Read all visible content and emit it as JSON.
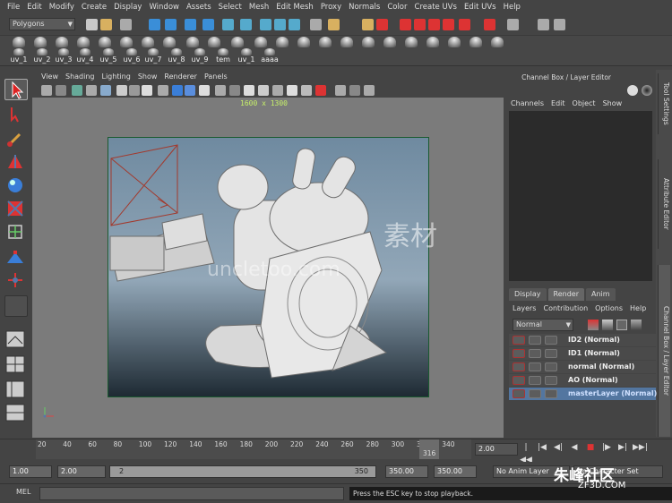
{
  "menubar": [
    "File",
    "Edit",
    "Modify",
    "Create",
    "Display",
    "Window",
    "Assets",
    "Select",
    "Mesh",
    "Edit Mesh",
    "Proxy",
    "Normals",
    "Color",
    "Create UVs",
    "Edit UVs",
    "Help"
  ],
  "statusline": {
    "menuset": "Polygons"
  },
  "shelf": {
    "items": [
      "uv_1",
      "uv_2",
      "uv_3",
      "uv_4",
      "uv_5",
      "uv_6",
      "uv_7",
      "uv_8",
      "uv_9",
      "tem",
      "uv_1",
      "aaaa"
    ]
  },
  "viewport": {
    "menu": [
      "View",
      "Shading",
      "Lighting",
      "Show",
      "Renderer",
      "Panels"
    ],
    "resolution": "1600 x 1300"
  },
  "channelbox": {
    "title": "Channel Box / Layer Editor",
    "menu": [
      "Channels",
      "Edit",
      "Object",
      "Show"
    ]
  },
  "sidetabs": [
    "Tool Settings",
    "Attribute Editor",
    "Channel Box / Layer Editor"
  ],
  "layers": {
    "tabs": [
      "Display",
      "Render",
      "Anim"
    ],
    "menu": [
      "Layers",
      "Contribution",
      "Options",
      "Help"
    ],
    "blend": "Normal",
    "rows": [
      "ID2 (Normal)",
      "ID1 (Normal)",
      "normal (Normal)",
      "AO (Normal)",
      "masterLayer (Normal)"
    ]
  },
  "timeline": {
    "ticks": [
      "20",
      "40",
      "60",
      "80",
      "100",
      "120",
      "140",
      "160",
      "180",
      "200",
      "220",
      "240",
      "260",
      "280",
      "300",
      "320",
      "340"
    ],
    "current": "316",
    "field": "2.00"
  },
  "range": {
    "start": "1.00",
    "start2": "2.00",
    "slider_start": "2",
    "slider_end": "350",
    "end": "350.00",
    "end2": "350.00",
    "anim_layer": "No Anim Layer",
    "char_set": "No Character Set"
  },
  "cmd": {
    "label": "MEL",
    "help": "Press the ESC key to stop playback."
  },
  "watermark": {
    "text1": "素材",
    "text2": "uncletoo.com",
    "corner1": "朱峰社区",
    "corner2": "ZF3D.COM"
  }
}
